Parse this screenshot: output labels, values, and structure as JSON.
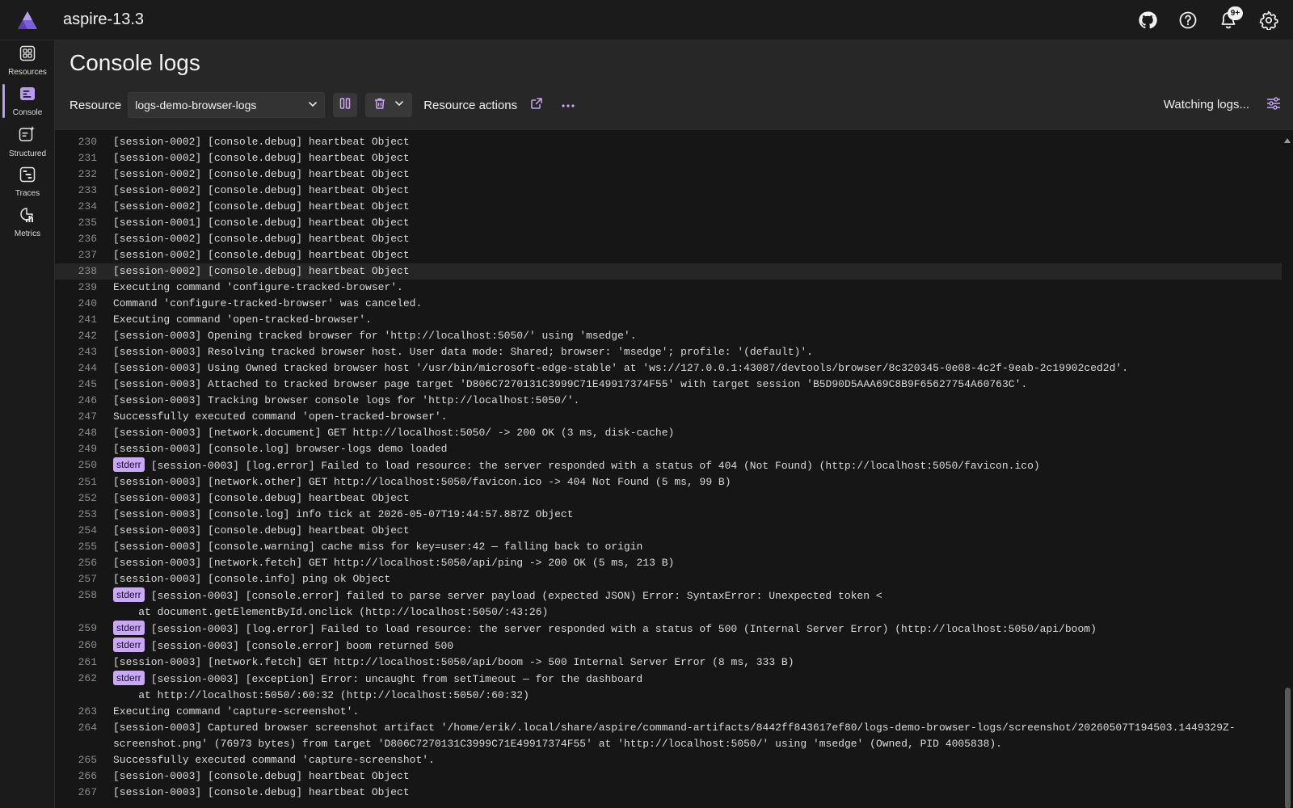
{
  "app": {
    "title": "aspire-13.3"
  },
  "header": {
    "notifications_badge": "9+"
  },
  "nav": {
    "items": [
      {
        "label": "Resources",
        "icon": "grid-icon"
      },
      {
        "label": "Console",
        "icon": "console-icon",
        "active": true
      },
      {
        "label": "Structured",
        "icon": "structured-logs-icon"
      },
      {
        "label": "Traces",
        "icon": "traces-icon"
      },
      {
        "label": "Metrics",
        "icon": "metrics-icon"
      }
    ]
  },
  "page": {
    "title": "Console logs"
  },
  "toolbar": {
    "resource_label": "Resource",
    "resource_value": "logs-demo-browser-logs",
    "resource_actions_label": "Resource actions",
    "status_text": "Watching logs..."
  },
  "colors": {
    "accent": "#b89cf0",
    "stderr_badge": "#c9a8f5",
    "background": "#161616"
  },
  "logs": [
    {
      "n": "230",
      "text": "[session-0002] [console.debug] heartbeat Object"
    },
    {
      "n": "231",
      "text": "[session-0002] [console.debug] heartbeat Object"
    },
    {
      "n": "232",
      "text": "[session-0002] [console.debug] heartbeat Object"
    },
    {
      "n": "233",
      "text": "[session-0002] [console.debug] heartbeat Object"
    },
    {
      "n": "234",
      "text": "[session-0002] [console.debug] heartbeat Object"
    },
    {
      "n": "235",
      "text": "[session-0001] [console.debug] heartbeat Object"
    },
    {
      "n": "236",
      "text": "[session-0002] [console.debug] heartbeat Object"
    },
    {
      "n": "237",
      "text": "[session-0002] [console.debug] heartbeat Object"
    },
    {
      "n": "238",
      "text": "[session-0002] [console.debug] heartbeat Object",
      "hl": true
    },
    {
      "n": "239",
      "text": "Executing command 'configure-tracked-browser'."
    },
    {
      "n": "240",
      "text": "Command 'configure-tracked-browser' was canceled."
    },
    {
      "n": "241",
      "text": "Executing command 'open-tracked-browser'."
    },
    {
      "n": "242",
      "text": "[session-0003] Opening tracked browser for 'http://localhost:5050/' using 'msedge'."
    },
    {
      "n": "243",
      "text": "[session-0003] Resolving tracked browser host. User data mode: Shared; browser: 'msedge'; profile: '(default)'."
    },
    {
      "n": "244",
      "text": "[session-0003] Using Owned tracked browser host '/usr/bin/microsoft-edge-stable' at 'ws://127.0.0.1:43087/devtools/browser/8c320345-0e08-4c2f-9eab-2c19902ced2d'."
    },
    {
      "n": "245",
      "text": "[session-0003] Attached to tracked browser page target 'D806C7270131C3999C71E49917374F55' with target session 'B5D90D5AAA69C8B9F65627754A60763C'."
    },
    {
      "n": "246",
      "text": "[session-0003] Tracking browser console logs for 'http://localhost:5050/'."
    },
    {
      "n": "247",
      "text": "Successfully executed command 'open-tracked-browser'."
    },
    {
      "n": "248",
      "text": "[session-0003] [network.document] GET http://localhost:5050/ -> 200 OK (3 ms, disk-cache)"
    },
    {
      "n": "249",
      "text": "[session-0003] [console.log] browser-logs demo loaded"
    },
    {
      "n": "250",
      "badge": "stderr",
      "text": "[session-0003] [log.error] Failed to load resource: the server responded with a status of 404 (Not Found) (http://localhost:5050/favicon.ico)"
    },
    {
      "n": "251",
      "text": "[session-0003] [network.other] GET http://localhost:5050/favicon.ico -> 404 Not Found (5 ms, 99 B)"
    },
    {
      "n": "252",
      "text": "[session-0003] [console.debug] heartbeat Object"
    },
    {
      "n": "253",
      "text": "[session-0003] [console.log] info tick at 2026-05-07T19:44:57.887Z Object"
    },
    {
      "n": "254",
      "text": "[session-0003] [console.debug] heartbeat Object"
    },
    {
      "n": "255",
      "text": "[session-0003] [console.warning] cache miss for key=user:42 — falling back to origin"
    },
    {
      "n": "256",
      "text": "[session-0003] [network.fetch] GET http://localhost:5050/api/ping -> 200 OK (5 ms, 213 B)"
    },
    {
      "n": "257",
      "text": "[session-0003] [console.info] ping ok Object"
    },
    {
      "n": "258",
      "badge": "stderr",
      "text": "[session-0003] [console.error] failed to parse server payload (expected JSON) Error: SyntaxError: Unexpected token <\n    at document.getElementById.onclick (http://localhost:5050/:43:26)"
    },
    {
      "n": "259",
      "badge": "stderr",
      "text": "[session-0003] [log.error] Failed to load resource: the server responded with a status of 500 (Internal Server Error) (http://localhost:5050/api/boom)"
    },
    {
      "n": "260",
      "badge": "stderr",
      "text": "[session-0003] [console.error] boom returned 500"
    },
    {
      "n": "261",
      "text": "[session-0003] [network.fetch] GET http://localhost:5050/api/boom -> 500 Internal Server Error (8 ms, 333 B)"
    },
    {
      "n": "262",
      "badge": "stderr",
      "text": "[session-0003] [exception] Error: uncaught from setTimeout — for the dashboard\n    at http://localhost:5050/:60:32 (http://localhost:5050/:60:32)"
    },
    {
      "n": "263",
      "text": "Executing command 'capture-screenshot'."
    },
    {
      "n": "264",
      "text": "[session-0003] Captured browser screenshot artifact '/home/erik/.local/share/aspire/command-artifacts/8442ff843617ef80/logs-demo-browser-logs/screenshot/20260507T194503.1449329Z-screenshot.png' (76973 bytes) from target 'D806C7270131C3999C71E49917374F55' at 'http://localhost:5050/' using 'msedge' (Owned, PID 4005838)."
    },
    {
      "n": "265",
      "text": "Successfully executed command 'capture-screenshot'."
    },
    {
      "n": "266",
      "text": "[session-0003] [console.debug] heartbeat Object"
    },
    {
      "n": "267",
      "text": "[session-0003] [console.debug] heartbeat Object"
    }
  ]
}
